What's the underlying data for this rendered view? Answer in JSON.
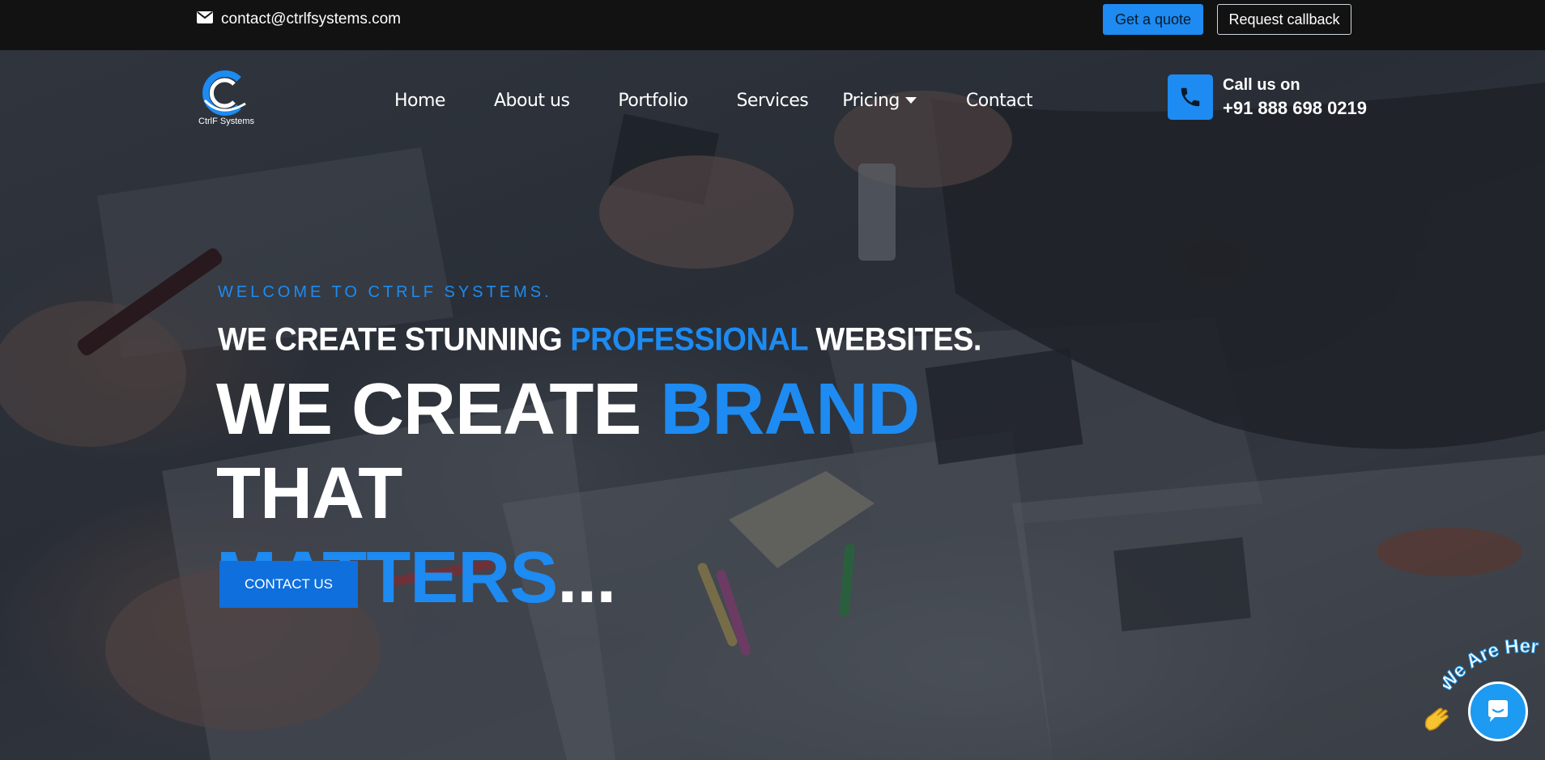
{
  "topbar": {
    "email": "contact@ctrlfsystems.com",
    "email_icon": "envelope-icon",
    "quote_label": "Get a quote",
    "callback_label": "Request callback"
  },
  "nav": {
    "logo_text": "CtrlF Systems",
    "items": [
      {
        "label": "Home"
      },
      {
        "label": "About us"
      },
      {
        "label": "Portfolio"
      },
      {
        "label": "Services"
      },
      {
        "label": "Pricing",
        "has_dropdown": true
      },
      {
        "label": "Contact"
      }
    ],
    "call_label": "Call us on",
    "call_number": "+91 888 698 0219",
    "call_icon": "phone-icon"
  },
  "hero": {
    "welcome": "WELCOME TO CTRLF SYSTEMS.",
    "subhead_pre": "WE CREATE STUNNING ",
    "subhead_accent": "PROFESSIONAL",
    "subhead_post": " WEBSITES.",
    "headline_pre": "WE CREATE ",
    "headline_accent": "BRAND",
    "headline_mid": " THAT",
    "headline_line2_accent": "MATTERS",
    "headline_line2_post": "...",
    "cta_label": "CONTACT US"
  },
  "chat": {
    "badge_text": "We Are Here!",
    "wave_icon": "waving-hand-icon",
    "bubble_icon": "chat-bubble-icon"
  },
  "colors": {
    "accent": "#1d8bf1",
    "topbar_bg": "#121212",
    "cta_bg": "#0f6fdc"
  }
}
